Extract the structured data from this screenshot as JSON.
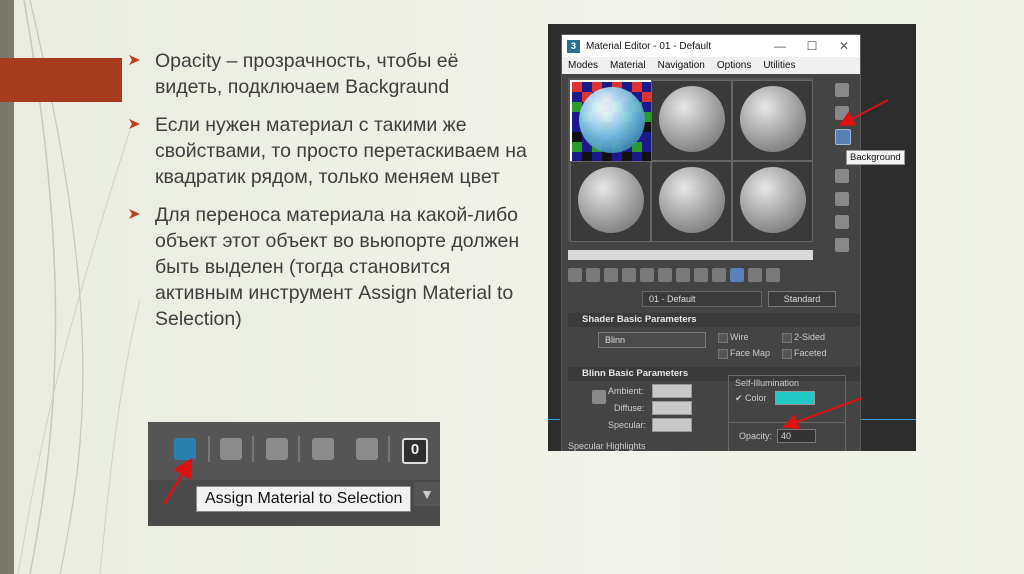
{
  "slide": {
    "bullets": [
      "Opacity – прозрачность, чтобы её видеть, подключаем Backgraund",
      "Если нужен материал с такими же свойствами, то просто перетаскиваем на квадратик рядом, только меняем цвет",
      " Для переноса материала на какой-либо объект этот объект во вьюпорте должен быть выделен (тогда становится активным инструмент Assign Material to Selection)"
    ],
    "colors": {
      "accent_red": "#a83a1d",
      "bullet_red": "#b7411d",
      "band": "#7b7a66"
    }
  },
  "material_editor": {
    "app_icon": "3",
    "title": "Material Editor - 01 - Default",
    "window_buttons": [
      "—",
      "☐",
      "✕"
    ],
    "menu": [
      "Modes",
      "Material",
      "Navigation",
      "Options",
      "Utilities"
    ],
    "tooltip": "Background",
    "material_name": "01 - Default",
    "material_type": "Standard",
    "shader_rollout": "Shader Basic Parameters",
    "shader": "Blinn",
    "checkboxes": [
      "Wire",
      "2-Sided",
      "Face Map",
      "Faceted"
    ],
    "blinn_rollout": "Blinn Basic Parameters",
    "self_illum_label": "Self-Illumination",
    "color_label": "Color",
    "ambient": "Ambient:",
    "diffuse": "Diffuse:",
    "specular": "Specular:",
    "opacity_label": "Opacity:",
    "opacity_value": "40",
    "specular_highlights": "Specular Highlights"
  },
  "inset": {
    "tooltip": "Assign Material to Selection",
    "zero_label": "0",
    "dropdown": "▼"
  }
}
